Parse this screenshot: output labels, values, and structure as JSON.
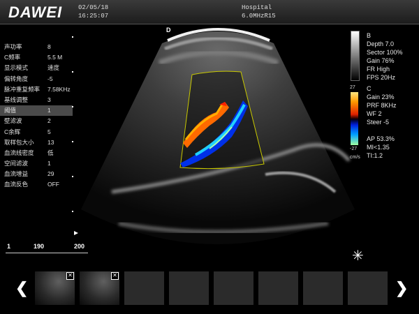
{
  "header": {
    "logo": "DAWEI",
    "date": "02/05/18",
    "time": "16:25:07",
    "hospital": "Hospital",
    "probe_info": "6.0MHzR15"
  },
  "params": [
    {
      "label": "声功率",
      "value": "8"
    },
    {
      "label": "C频率",
      "value": "5.5 M"
    },
    {
      "label": "显示模式",
      "value": "速度"
    },
    {
      "label": "偏转角度",
      "value": "-5"
    },
    {
      "label": "脉冲重复频率",
      "value": "7.58KHz"
    },
    {
      "label": "基线调整",
      "value": "3"
    },
    {
      "label": "阈值",
      "value": "1"
    },
    {
      "label": "壁滤波",
      "value": "2"
    },
    {
      "label": "C余辉",
      "value": "5"
    },
    {
      "label": "取样包大小",
      "value": "13"
    },
    {
      "label": "血流线密度",
      "value": "低"
    },
    {
      "label": "空间滤波",
      "value": "1"
    },
    {
      "label": "血流增益",
      "value": "29"
    },
    {
      "label": "血流反色",
      "value": "OFF"
    }
  ],
  "selected_param_index": 6,
  "right_panel": {
    "b_mode": "B",
    "depth": "Depth 7.0",
    "sector": "Sector 100%",
    "gain": "Gain 76%",
    "fr": "FR High",
    "fps": "FPS 20Hz",
    "c_mode": "C",
    "c_gain": "Gain  23%",
    "prf": "PRF 8KHz",
    "wf": "WF 2",
    "steer": "Steer -5",
    "ap": "AP 53.3%",
    "mi": "MI<1.35",
    "ti": "TI:1.2",
    "scale_top": "27",
    "scale_bottom": "-27",
    "scale_unit": "cm/s"
  },
  "image": {
    "depth_marker": "D",
    "scale_left": "1",
    "scale_mid": "190",
    "scale_right": "200"
  },
  "thumbnails": {
    "close_symbol": "✕",
    "prev_arrow": "❮",
    "next_arrow": "❯",
    "probe_icon": "✳"
  }
}
